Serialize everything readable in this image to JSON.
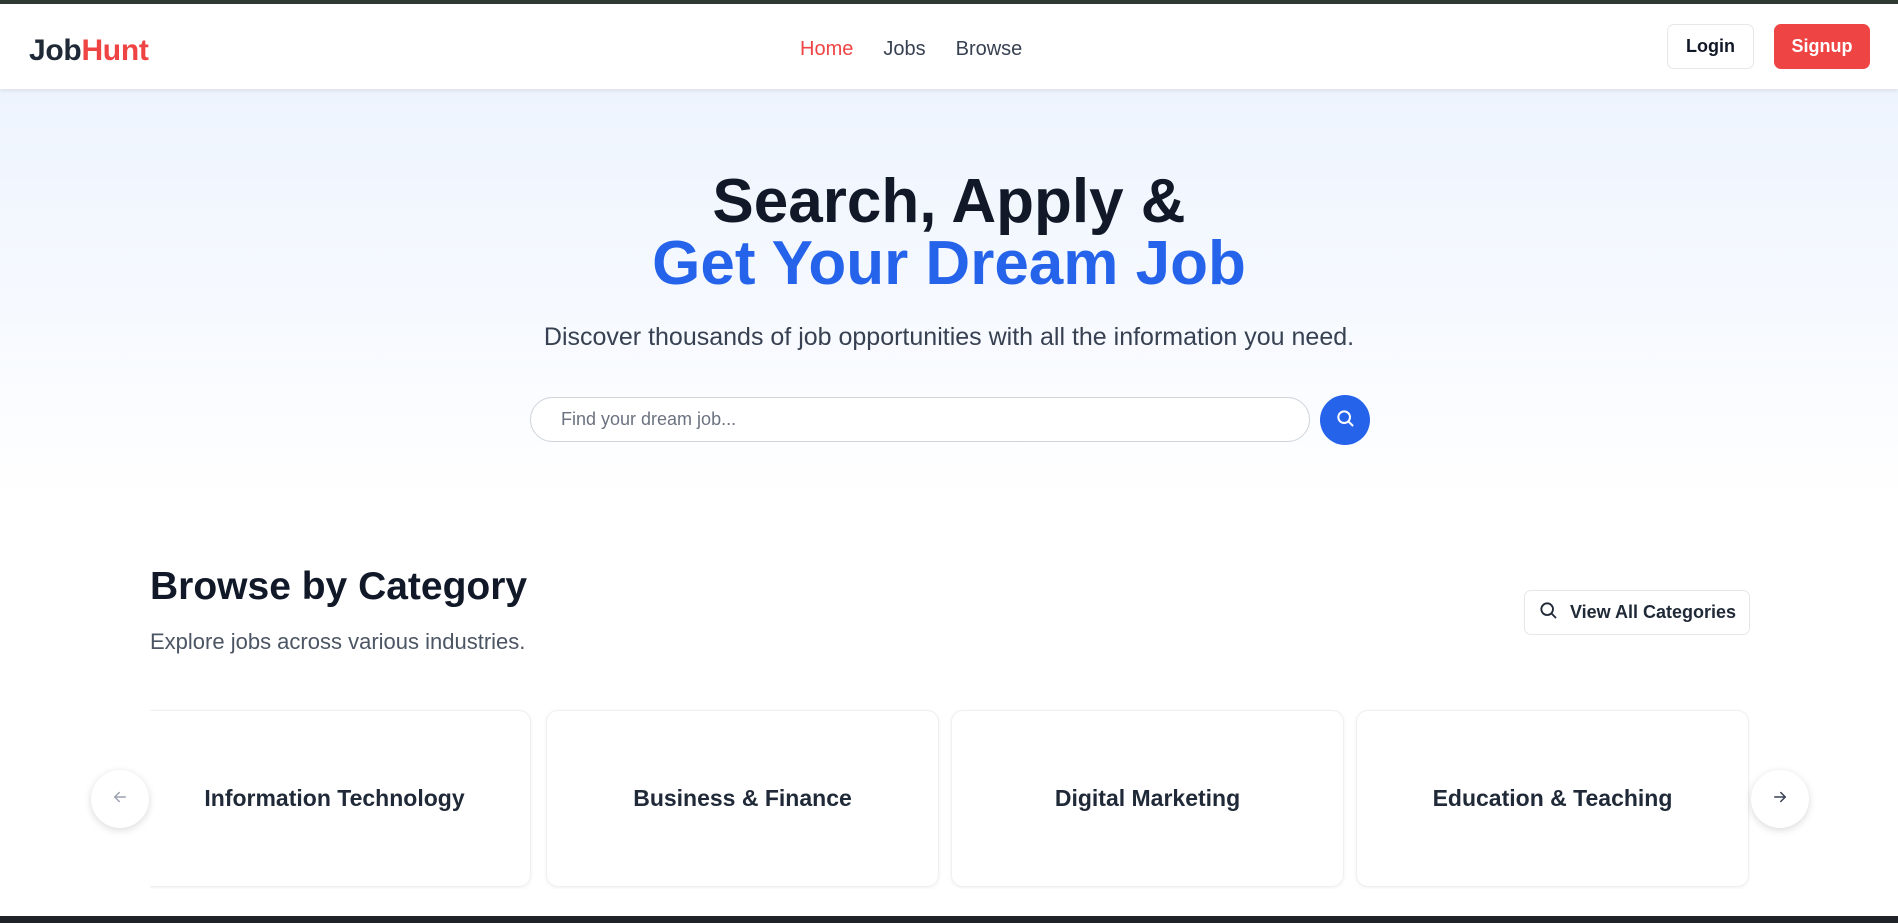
{
  "navbar": {
    "logo": {
      "part1": "Job",
      "part2": "Hunt"
    },
    "links": [
      {
        "label": "Home",
        "active": true
      },
      {
        "label": "Jobs",
        "active": false
      },
      {
        "label": "Browse",
        "active": false
      }
    ],
    "login_label": "Login",
    "signup_label": "Signup"
  },
  "hero": {
    "title_line1": "Search, Apply &",
    "title_line2": "Get Your Dream Job",
    "subtitle": "Discover thousands of job opportunities with all the information you need.",
    "search_placeholder": "Find your dream job...",
    "search_icon": "search-icon"
  },
  "categories": {
    "title": "Browse by Category",
    "subtitle": "Explore jobs across various industries.",
    "view_all_label": "View All Categories",
    "items": [
      {
        "label": "Information Technology"
      },
      {
        "label": "Business & Finance"
      },
      {
        "label": "Digital Marketing"
      },
      {
        "label": "Education & Teaching"
      }
    ],
    "prev_icon": "arrow-left-icon",
    "next_icon": "arrow-right-icon"
  },
  "colors": {
    "accent_red": "#ef4444",
    "accent_blue": "#2563eb",
    "text_dark": "#111827"
  }
}
